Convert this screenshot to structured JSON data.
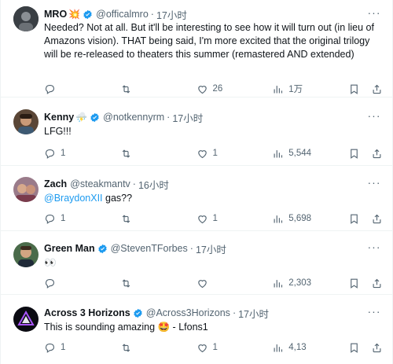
{
  "tweets": [
    {
      "name": "MRO",
      "name_emoji": "💥",
      "handle": "@officalmro",
      "dot": "·",
      "time": "17小时",
      "text": "Needed? Not at all. But it'll be interesting to see how it will turn out (in lieu of Amazons vision). THAT being said, I'm more excited that the original trilogy will be re-released to theaters this summer (remastered AND extended)",
      "replies": "",
      "retweets": "",
      "likes": "26",
      "views": "1万",
      "verified": true
    },
    {
      "name": "Kenny",
      "name_emoji": "⛈️",
      "handle": "@notkennyrm",
      "dot": "·",
      "time": "17小时",
      "text": "LFG!!!",
      "replies": "1",
      "retweets": "",
      "likes": "1",
      "views": "5,544",
      "verified": true
    },
    {
      "name": "Zach",
      "name_emoji": "",
      "handle": "@steakmantv",
      "dot": "·",
      "time": "16小时",
      "mention": "@BraydonXII",
      "text": " gas??",
      "replies": "1",
      "retweets": "",
      "likes": "1",
      "views": "5,698",
      "verified": false
    },
    {
      "name": "Green Man",
      "name_emoji": "",
      "handle": "@StevenTForbes",
      "dot": "·",
      "time": "17小时",
      "text": "👀",
      "replies": "",
      "retweets": "",
      "likes": "",
      "views": "2,303",
      "verified": true
    },
    {
      "name": "Across 3 Horizons",
      "name_emoji": "",
      "handle": "@Across3Horizons",
      "dot": "·",
      "time": "17小时",
      "text": "This is sounding amazing 🤩 - Lfons1",
      "replies": "1",
      "retweets": "",
      "likes": "1",
      "views": "4,13",
      "verified": true
    }
  ],
  "colors": {
    "accent": "#1d9bf0",
    "muted": "#536471",
    "text": "#0f1419",
    "border": "#eff3f4"
  },
  "icons": [
    "reply-icon",
    "retweet-icon",
    "like-icon",
    "views-icon",
    "bookmark-icon",
    "share-icon",
    "more-icon",
    "verified-icon"
  ]
}
